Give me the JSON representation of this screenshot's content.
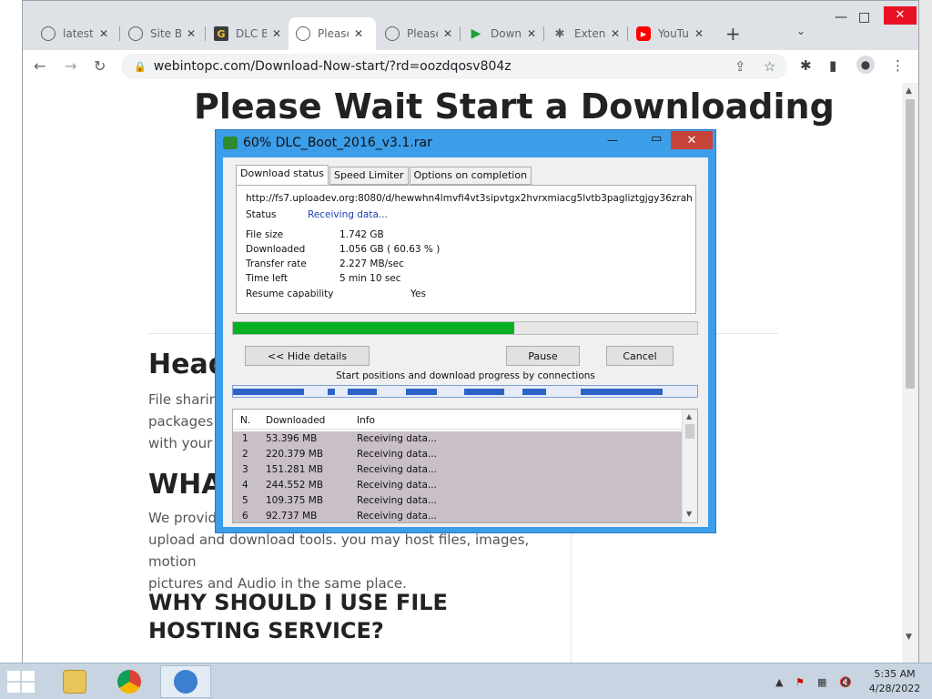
{
  "browser": {
    "tabs": [
      {
        "label": "latest",
        "icon": "globe-icon"
      },
      {
        "label": "Site B",
        "icon": "globe-icon"
      },
      {
        "label": "DLC B",
        "icon": "g-logo-icon"
      },
      {
        "label": "Please",
        "icon": "globe-icon"
      },
      {
        "label": "Please",
        "icon": "globe-icon"
      },
      {
        "label": "Down",
        "icon": "play-icon"
      },
      {
        "label": "Exten",
        "icon": "puzzle-icon"
      },
      {
        "label": "YouTu",
        "icon": "youtube-icon"
      }
    ],
    "url": "webintopc.com/Download-Now-start/?rd=oozdqosv804z"
  },
  "page": {
    "title": "Please Wait Start a Downloading",
    "heading1": "Head",
    "para1": [
      "File sharing",
      "packages t",
      "with your C"
    ],
    "heading2": "WHA",
    "para2": [
      "We provide",
      "upload and download tools. you may host files, images, motion",
      "pictures and Audio in the same place."
    ],
    "heading3": "WHY SHOULD I USE FILE HOSTING SERVICE?"
  },
  "idm": {
    "title": "60% DLC_Boot_2016_v3.1.rar",
    "tabs": [
      "Download status",
      "Speed Limiter",
      "Options on completion"
    ],
    "url": "http://fs7.uploadev.org:8080/d/hewwhn4lmvfi4vt3sipvtgx2hvrxmiacg5lvtb3pagliztgjgy36zrahecwv7",
    "status_label": "Status",
    "status_value": "Receiving data...",
    "file_size_label": "File size",
    "file_size_value": "1.742  GB",
    "downloaded_label": "Downloaded",
    "downloaded_value": "1.056  GB  ( 60.63 % )",
    "rate_label": "Transfer rate",
    "rate_value": "2.227  MB/sec",
    "time_label": "Time left",
    "time_value": "5 min 10 sec",
    "resume_label": "Resume capability",
    "resume_value": "Yes",
    "progress": 0.6063,
    "buttons": {
      "hide": "<< Hide details",
      "pause": "Pause",
      "cancel": "Cancel"
    },
    "connections_label": "Start positions and download progress by connections",
    "columns": [
      "N.",
      "Downloaded",
      "Info"
    ],
    "connections": [
      {
        "n": "1",
        "downloaded": "53.396  MB",
        "info": "Receiving data..."
      },
      {
        "n": "2",
        "downloaded": "220.379  MB",
        "info": "Receiving data..."
      },
      {
        "n": "3",
        "downloaded": "151.281  MB",
        "info": "Receiving data..."
      },
      {
        "n": "4",
        "downloaded": "244.552  MB",
        "info": "Receiving data..."
      },
      {
        "n": "5",
        "downloaded": "109.375  MB",
        "info": "Receiving data..."
      },
      {
        "n": "6",
        "downloaded": "92.737  MB",
        "info": "Receiving data..."
      }
    ]
  },
  "taskbar": {
    "time": "5:35 AM",
    "date": "4/28/2022"
  },
  "colors": {
    "progress_fill": "#06b025",
    "idm_frame": "#3c9de8",
    "close_red": "#c7433a"
  }
}
